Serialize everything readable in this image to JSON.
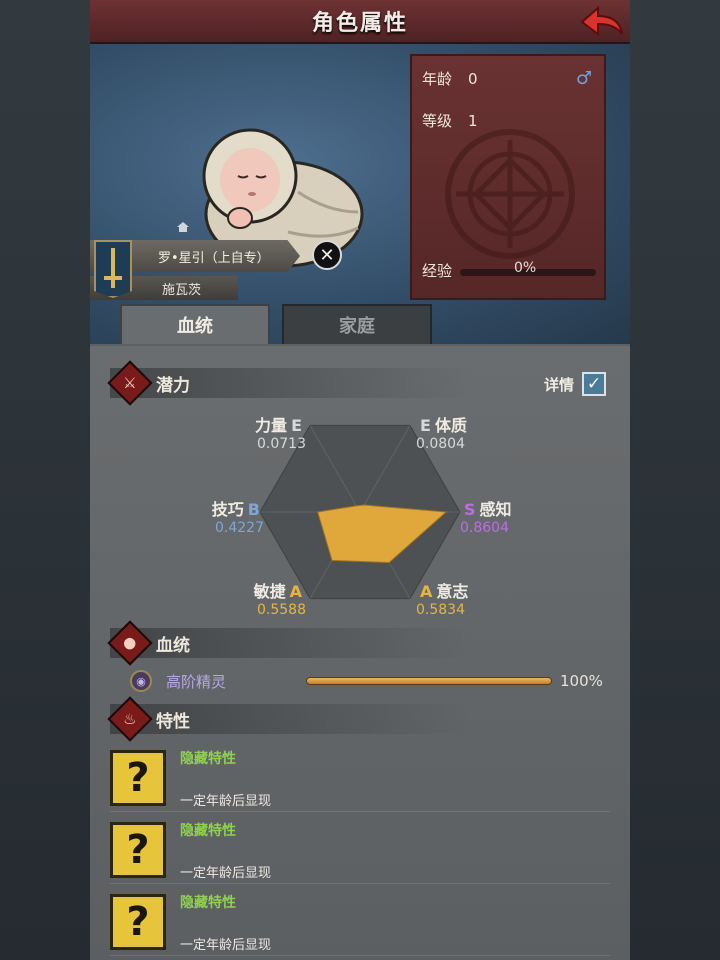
{
  "header": {
    "title": "角色属性"
  },
  "character": {
    "name": "罗•星引（上自专）",
    "family": "施瓦茨",
    "age_label": "年龄",
    "age": "0",
    "gender_symbol": "♂",
    "level_label": "等级",
    "level": "1",
    "exp_label": "经验",
    "exp_percent_text": "0%",
    "exp_fraction": 0
  },
  "tabs": [
    {
      "label": "血统",
      "active": true
    },
    {
      "label": "家庭",
      "active": false
    }
  ],
  "potential": {
    "title": "潜力",
    "detail_label": "详情",
    "detail_checked": true,
    "stats": [
      {
        "name": "力量",
        "grade": "E",
        "value": "0.0713",
        "v": 0.0713,
        "color": "#d8d8d8"
      },
      {
        "name": "体质",
        "grade": "E",
        "value": "0.0804",
        "v": 0.0804,
        "color": "#d8d8d8"
      },
      {
        "name": "感知",
        "grade": "S",
        "value": "0.8604",
        "v": 0.8604,
        "color": "#c06be6"
      },
      {
        "name": "意志",
        "grade": "A",
        "value": "0.5834",
        "v": 0.5834,
        "color": "#e5b542"
      },
      {
        "name": "敏捷",
        "grade": "A",
        "value": "0.5588",
        "v": 0.5588,
        "color": "#e5b542"
      },
      {
        "name": "技巧",
        "grade": "B",
        "value": "0.4227",
        "v": 0.4227,
        "color": "#7fa6d4"
      }
    ]
  },
  "bloodline": {
    "title": "血统",
    "name": "高阶精灵",
    "percent_text": "100%",
    "fraction": 1.0
  },
  "traits": {
    "title": "特性",
    "items": [
      {
        "name": "隐藏特性",
        "desc": "一定年龄后显现"
      },
      {
        "name": "隐藏特性",
        "desc": "一定年龄后显现"
      },
      {
        "name": "隐藏特性",
        "desc": "一定年龄后显现"
      }
    ]
  },
  "colors": {
    "accent_red": "#6d3234",
    "radar_fill": "#e0a83a",
    "trait_name": "#8fd14f"
  }
}
